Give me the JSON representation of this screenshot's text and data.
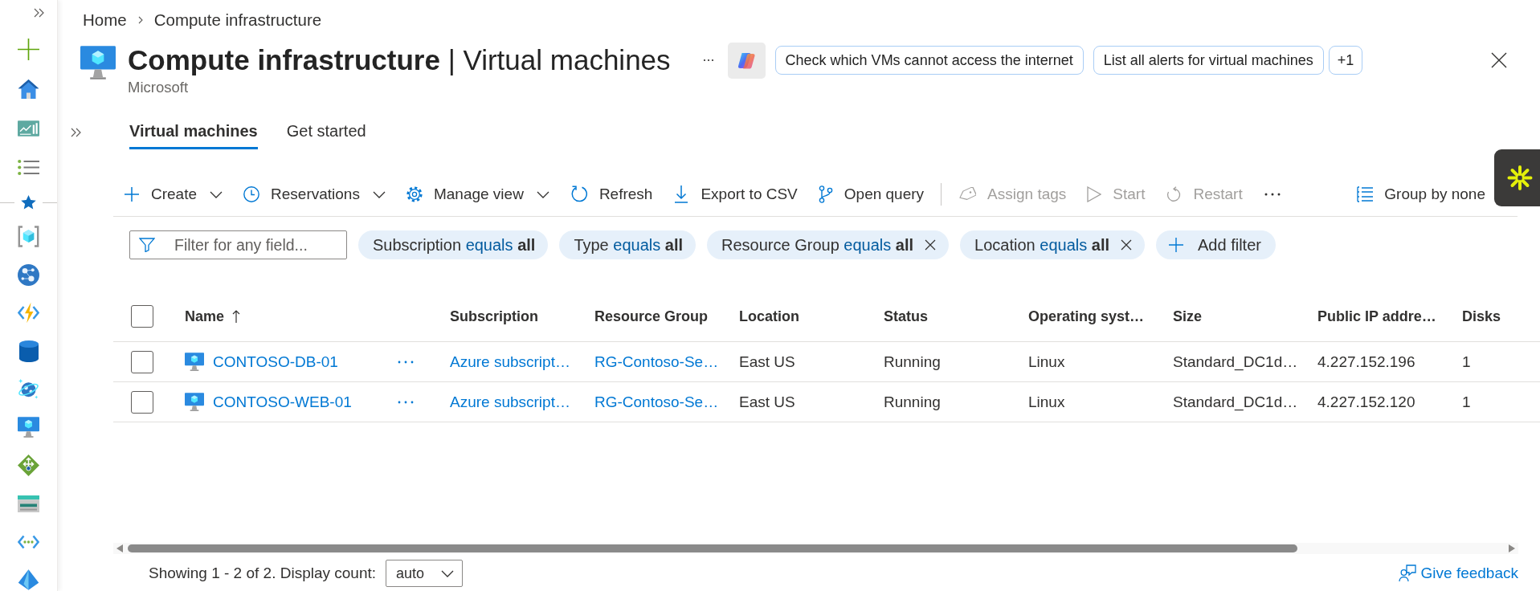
{
  "breadcrumb": [
    {
      "label": "Home"
    },
    {
      "label": "Compute infrastructure"
    }
  ],
  "header": {
    "title": "**Compute infrastructure** | Virtual machines",
    "subtitle": "Microsoft",
    "suggestions": [
      "Check which VMs cannot access the internet",
      "List all alerts for virtual machines"
    ],
    "more_suggestions": "+1"
  },
  "tabs": [
    {
      "label": "Virtual machines",
      "selected": true
    },
    {
      "label": "Get started",
      "selected": false
    }
  ],
  "toolbar": {
    "actions": [
      {
        "label": "Create",
        "dropdown": true,
        "disabled": false
      },
      {
        "label": "Reservations",
        "dropdown": true,
        "disabled": false
      },
      {
        "label": "Manage view",
        "dropdown": true,
        "disabled": false
      },
      {
        "label": "Refresh",
        "dropdown": false,
        "disabled": false
      },
      {
        "label": "Export to CSV",
        "dropdown": false,
        "disabled": false
      },
      {
        "label": "Open query",
        "dropdown": false,
        "disabled": false
      }
    ],
    "selection_actions": [
      {
        "label": "Assign tags",
        "disabled": true
      },
      {
        "label": "Start",
        "disabled": true
      },
      {
        "label": "Restart",
        "disabled": true
      }
    ],
    "group_by": "Group by none"
  },
  "filter_bar": {
    "search": {
      "placeholder": "Filter for any field..."
    },
    "filters": [
      {
        "field": "Subscription",
        "operator": "equals",
        "value": "all",
        "removable": false
      },
      {
        "field": "Type",
        "operator": "equals",
        "value": "all",
        "removable": false
      },
      {
        "field": "Resource Group",
        "operator": "equals",
        "value": "all",
        "removable": true
      },
      {
        "field": "Location",
        "operator": "equals",
        "value": "all",
        "removable": true
      }
    ],
    "add_filter": "Add filter"
  },
  "table": {
    "all_selected": false,
    "sort_descending": false,
    "columns": [
      {
        "label": "Name",
        "sorted": true
      },
      {
        "label": "Subscription",
        "sorted": false
      },
      {
        "label": "Resource Group",
        "sorted": false
      },
      {
        "label": "Location",
        "sorted": false
      },
      {
        "label": "Status",
        "sorted": false
      },
      {
        "label": "Operating syst…",
        "sorted": false
      },
      {
        "label": "Size",
        "sorted": false
      },
      {
        "label": "Public IP addre…",
        "sorted": false
      },
      {
        "label": "Disks",
        "sorted": false
      }
    ],
    "rows": [
      {
        "selected": false,
        "name": "CONTOSO-DB-01",
        "subscription": "Azure subscript…",
        "resource_group": "RG-Contoso-Se…",
        "location": "East US",
        "status": "Running",
        "operating_system": "Linux",
        "size": "Standard_DC1d…",
        "public_ip_address": "4.227.152.196",
        "disks": "1"
      },
      {
        "selected": false,
        "name": "CONTOSO-WEB-01",
        "subscription": "Azure subscript…",
        "resource_group": "RG-Contoso-Se…",
        "location": "East US",
        "status": "Running",
        "operating_system": "Linux",
        "size": "Standard_DC1d…",
        "public_ip_address": "4.227.152.120",
        "disks": "1"
      }
    ]
  },
  "footer": {
    "summary": "Showing 1 - 2 of 2. Display count:",
    "display_count": "auto",
    "feedback": "Give feedback"
  }
}
